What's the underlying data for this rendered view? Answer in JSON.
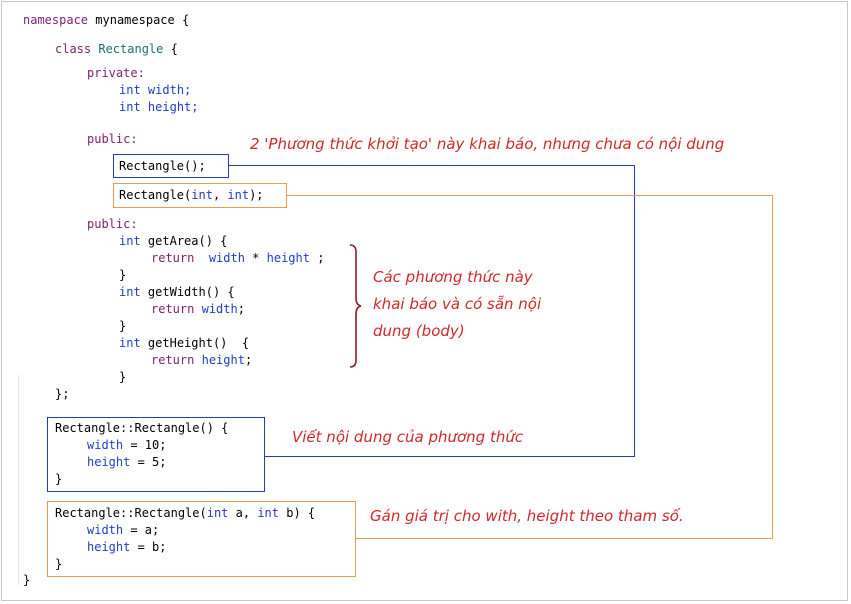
{
  "code": {
    "namespace_kw": "namespace",
    "namespace_name": "mynamespace {",
    "class_kw": "class",
    "class_name": "Rectangle",
    "class_open": " {",
    "private_kw": "private:",
    "int1": "int",
    "width_decl": "width;",
    "int2": "int",
    "height_decl": "height;",
    "public1_kw": "public:",
    "ctor1": "Rectangle();",
    "ctor2_name": "Rectangle(",
    "ctor2_int1": "int",
    "ctor2_sep": ", ",
    "ctor2_int2": "int",
    "ctor2_end": ");",
    "public2_kw": "public:",
    "getArea_int": "int",
    "getArea_sig": "getArea() {",
    "return1": "return",
    "ret1_width": "width",
    "ret1_op": " * ",
    "ret1_height": "height",
    "ret1_end": " ;",
    "close1": "}",
    "getWidth_int": "int",
    "getWidth_sig": "getWidth() {",
    "return2": "return",
    "ret2_width": "width",
    "ret2_end": ";",
    "close2": "}",
    "getHeight_int": "int",
    "getHeight_sig": "getHeight()  {",
    "return3": "return",
    "ret3_height": "height",
    "ret3_end": ";",
    "close3": "}",
    "class_close": "};",
    "impl1_sig": "Rectangle::Rectangle() {",
    "impl1_width": "width",
    "impl1_width_val": " = 10;",
    "impl1_height": "height",
    "impl1_height_val": " = 5;",
    "impl1_close": "}",
    "impl2_sig_a": "Rectangle::Rectangle(",
    "impl2_int1": "int",
    "impl2_mid": " a, ",
    "impl2_int2": "int",
    "impl2_end": " b) {",
    "impl2_width": "width",
    "impl2_width_val": " = a;",
    "impl2_height": "height",
    "impl2_height_val": " = b;",
    "impl2_close": "}",
    "namespace_close": "}"
  },
  "notes": {
    "ctor_note": "2 'Phương thức khởi tạo' này khai báo, nhưng chưa có nội dung",
    "methods_note_1": "Các phương thức này",
    "methods_note_2": "khai báo và có sẵn nội",
    "methods_note_3": "dung (body)",
    "impl1_note": "Viết nội dung của phương thức",
    "impl2_note": "Gán giá trị cho with, height theo tham số."
  },
  "colors": {
    "blue_box": "#2a3ca8",
    "orange_box": "#e0a050",
    "annotation": "#d02828",
    "brace": "#8b1a2b"
  }
}
